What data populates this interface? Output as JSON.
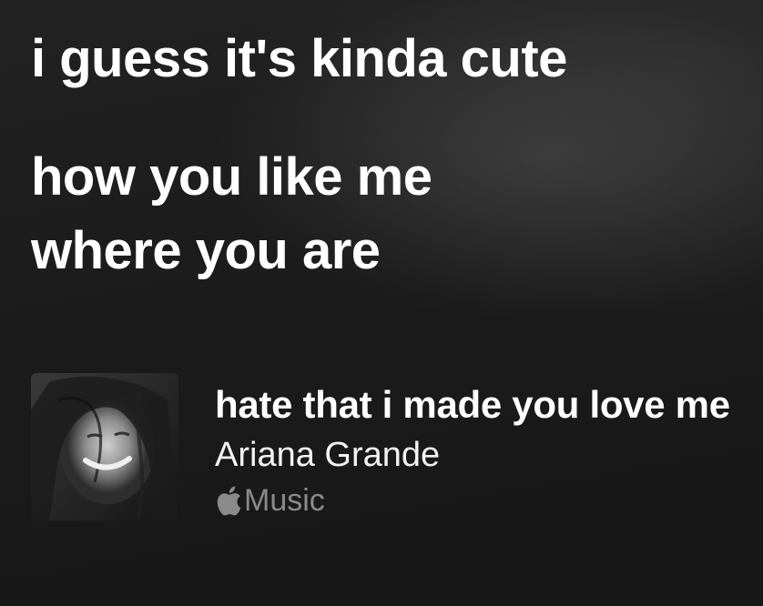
{
  "lyrics": {
    "lines": [
      "i guess it's kinda cute",
      "how you like me",
      "where you are"
    ]
  },
  "track": {
    "title": "hate that i made you love me",
    "artist": "Ariana Grande",
    "service_label": "Music",
    "service_icon": "apple-logo-icon",
    "artwork_icon": "album-art"
  },
  "colors": {
    "background": "#1a1a1a",
    "text_primary": "#ffffff",
    "text_secondary": "#8a8a8a"
  }
}
